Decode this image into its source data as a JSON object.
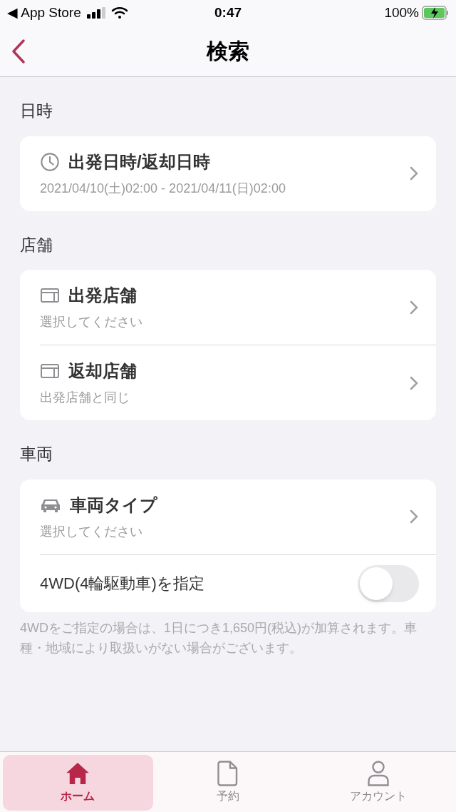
{
  "status_bar": {
    "back_app": "◀ App Store",
    "time": "0:47",
    "battery": "100%"
  },
  "nav": {
    "title": "検索"
  },
  "sections": [
    {
      "label": "日時",
      "rows": [
        {
          "kind": "link",
          "title": "出発日時/返却日時",
          "subtitle": "2021/04/10(土)02:00 - 2021/04/11(日)02:00"
        }
      ]
    },
    {
      "label": "店舗",
      "rows": [
        {
          "kind": "link",
          "title": "出発店舗",
          "subtitle": "選択してください"
        },
        {
          "kind": "link",
          "title": "返却店舗",
          "subtitle": "出発店舗と同じ"
        }
      ]
    },
    {
      "label": "車両",
      "rows": [
        {
          "kind": "link",
          "title": "車両タイプ",
          "subtitle": "選択してください"
        },
        {
          "kind": "toggle",
          "title": "4WD(4輪駆動車)を指定",
          "on": false
        }
      ]
    }
  ],
  "note": "4WDをご指定の場合は、1日につき1,650円(税込)が加算されます。車種・地域により取扱いがない場合がございます。",
  "tabs": [
    {
      "label": "ホーム",
      "selected": true
    },
    {
      "label": "予約",
      "selected": false
    },
    {
      "label": "アカウント",
      "selected": false
    }
  ]
}
